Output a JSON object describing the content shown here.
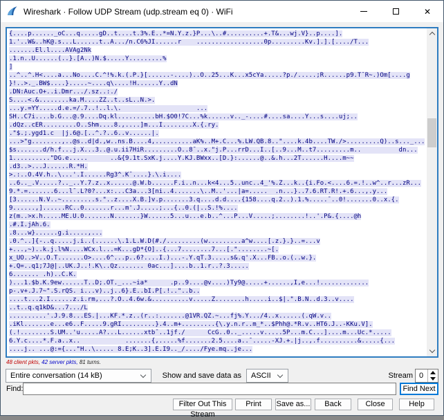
{
  "window": {
    "title": "Wireshark · Follow UDP Stream (udp.stream eq 0) · WiFi"
  },
  "stream_view": {
    "colors": {
      "server_text": "#000080",
      "server_highlight": "#e3e3f7",
      "client_stat_color": "#c00000",
      "server_stat_color": "#0000c8",
      "focus_border": "#2e7cc0"
    },
    "stats": {
      "client_pkts": "48 client pkts,",
      "server_pkts": " 42 server pkts,",
      "turns": " 81 turns."
    },
    "lines": [
      "{....p......_oC...q.....gD..t....t.3%.E..*=N.Y.z.}P...\\..#..........+.T&...wj.V}..p....].",
      "1.'..W&..hK@.s...L......t..A.../n.C6%JI......r    ..................0p.........Kv.].].[..../T...",
      ".......El.l....AVAg2Nk",
      ".1.n..U......(..}.[A..)N.$.....Y.........%",
      "]",
      "..^..^.H<....a...No....C.^!%.k.(.P.}[......-....)..O..25...K...x5cYa.....?p./.....;R......p9.T¯R~.)Om[....g",
      "}!..>._.BW$....}.....~....q\\....!H......Y..dN",
      ".DN:Auc.O+..i.Dmr.../.sz..:./",
      "S....<.&........ka.M....ZZ..t..sL..N.>.",
      "...y.=YY.....d.e.=/.7..!..l.\\.                    ...",
      "SH..C7i....b.G...@.9....Dq.kl..........bH.$O0!7C...%k......v.._-....#....sa....Y...s....uj;..",
      ".dQz..cER.........O..Shm....8.,....]m...I........X.{.ry.",
      ".\"$.;.ygd1.c  |j.6@.[..^.?..6..v......|.",
      "...>\"g........,..@s..d|d.,w..ns.B....4,..........aK%..M+.C...%.LW.QB.8..\"....k.4b....TW./>.........Q)..s..._...",
      "$s.......d/h.f...j.X...3..@.u.ii7HiR.........O..8¯..x.\"j.P...rrD...I..[..9...M..t7.........m..          dn...",
      "1..........\"DG.e.....      ..&{9.1t.SxK.j....Y.KJ.BWxx..[D.}:......@..&.h...2T......H....m~~",
      ".d3..>...J......R.*H.",
      ">.:..O.4V.h..\\...'.I......Rg3^.K¯....}.\\.i....",
      "..6.._.V.....?.._..Y.7.z..x......@.W.b......F.i..n...k<4...5..unc..4_'%.Z...k..{i.Fo.<....6.=.!..w^..r...zR...",
      "9.*.=.......6...l¯.L?0?...x:...C3a...3[ni..4.......\\..M..'...|a=.....  .n...}..7.6.RT.R!.+.6...,.y...",
      "[3......N.V..~.........s.\"..z....X.B.]v.p.......3.q....d.d....{158....q.2..).1.%.....¯..0!.......0..x.{.",
      "9......,]......RC..0.......r...m'.J.....;...{..0.(|..S.!%....",
      "z(m..>x.h.....ME.U.0.......N.......}W......5...u...e.b..^...P...V.....;........!..'.P&.{....@h",
      ".#.I.jAh.6.",
      ".8...w}......g.i.....,...",
      ".0.^..]{-..q.....j.i..(......\\.1.L.W.D(#./.........(w.........a^w....[.z.}.}..=...v",
      "+...,~)..k.j.l%N....WCx.l...=K...gD*{O]..{...7........7...[.\"........~[.",
      "x_UO..>V..O.T.......O>....6^...p..6?....I.)...-.Y.qT.3.....s&.q'.X...FB..o.(..w.}.",
      "+.Q=..q1;7J@|..UK.J..!.K\\..Qz....... 0ac...]....b..1.r..?.3.....",
      "6....... .h)..C.K.",
      ")...1.$b.K.9ew......T..D;.OT._...~ia*      .p..9....@v....)Ty9@.....+......,I,e...!.............",
      "p-.v+.J.7~\".S.rQS. i...v)..j..6}.E..bI.P[.!..\"..b..",
      "....t...2.I......z.i.rm,...?.O..4.6w.&..........v.....Z........h.....i..$|.\".B.N..d.3..v....",
      "..t..q.q1kD&...7.../L",
      "..........'.J.9.8...ES.|...KF.*.z..(r..:.......@1VR.QZ.~...fj%.Y.../4..x......(.qW.v..",
      ".iKl.......e...e6..F.....9.gRI.........}.4..m+.........{\\.y.n.r..m_*..$Phh@.*R.v..HT6.J..-KKu.V].",
      "(.!........S.UM..'u.....A?...L......xtb¯..1jf./      CcG..0.._.....v.....5P...m.C...]....m...Uc.*.....",
      "6.Y.c....*.F.a..x..            .......{,.....%f.......2.5....a..¯.....-XJ.+.|j..,.f..........&.....{...",
      "....j.. ...@:={...\"H..\\..... 8.E;K..3].E.I9.._/..../Fye.mq..je..."
    ]
  },
  "controls": {
    "conversation_dropdown": {
      "value": "Entire conversation (14 kB)"
    },
    "show_save_label": "Show and save data as",
    "format_dropdown": {
      "value": "ASCII"
    },
    "stream_label": "Stream",
    "stream_spinner_value": "0",
    "find_label": "Find:",
    "find_input": {
      "value": ""
    },
    "find_next_button": "Find Next"
  },
  "footer_buttons": {
    "filter_out": "Filter Out This Stream",
    "print": "Print",
    "save_as": "Save as...",
    "back": "Back",
    "close": "Close",
    "help": "Help"
  }
}
